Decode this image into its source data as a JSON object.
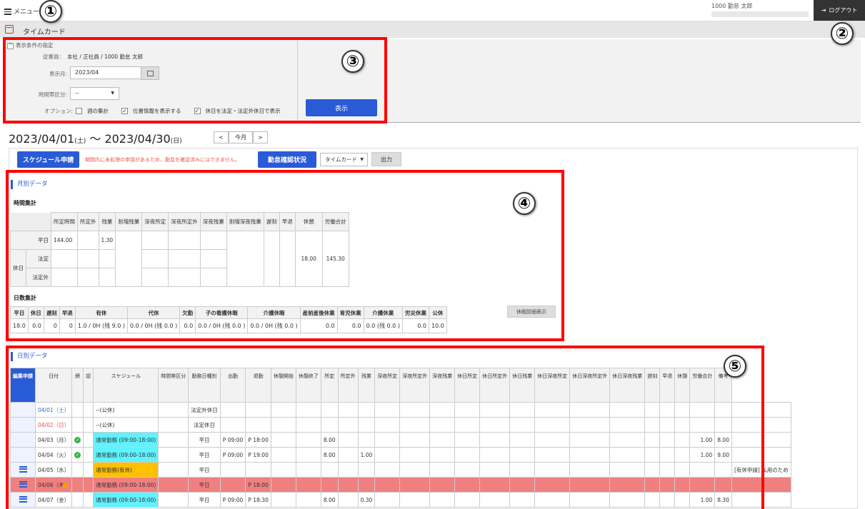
{
  "header": {
    "menu_label": "メニュー",
    "user_info": "1000 勤怠 太郎",
    "logout_label": "ログアウト"
  },
  "titlebar": {
    "title": "タイムカード"
  },
  "conditions": {
    "heading": "表示条件の指定",
    "employee_label": "従業員：",
    "employee_value": "本社 / 正社員 / 1000 勤怠 太郎",
    "month_label": "表示月:",
    "month_value": "2023/04",
    "timezone_label": "時間帯区分:",
    "timezone_value": "--",
    "options_label": "オプション:",
    "opt_weekly": "週の集計",
    "opt_location": "位置情報を表示する",
    "opt_holiday": "休日を法定・法定外休日で表示",
    "show_button": "表示"
  },
  "range": {
    "start": "2023/04/01",
    "start_dow": "(土)",
    "sep": " ～ ",
    "end": "2023/04/30",
    "end_dow": "(日)",
    "prev": "<",
    "this_month": "今月",
    "next": ">"
  },
  "toolbar": {
    "schedule_button": "スケジュール申請",
    "warning": "期間内に未処理の申請があるため、勤怠を確認済みにはできません。",
    "confirm_button": "勤怠確認状況",
    "view_select": "タイムカード",
    "output_button": "出力"
  },
  "monthly": {
    "title": "月別データ",
    "time_heading": "時間集計",
    "time_headers": [
      "所定時間",
      "所定外",
      "残業",
      "割増残業",
      "深夜所定",
      "深夜所定外",
      "深夜残業",
      "割増深夜残業",
      "遅刻",
      "早退",
      "休憩",
      "労働合計"
    ],
    "row_weekday": "平日",
    "row_holiday": "休日",
    "row_legal": "法定",
    "row_nonlegal": "法定外",
    "weekday_scheduled": "144.00",
    "weekday_overtime": "1.30",
    "break_total": "18.00",
    "work_total": "145.30",
    "days_heading": "日数集計",
    "days_headers": [
      "平日",
      "休日",
      "遅刻",
      "早退",
      "有休",
      "代休",
      "欠勤",
      "子の看護休暇",
      "介護休暇",
      "産前産後休業",
      "育児休業",
      "介護休業",
      "労災休業",
      "公休"
    ],
    "days_values": [
      "18.0",
      "0.0",
      "0",
      "0",
      "1.0 / 0H (残 9.0 )",
      "0.0 / 0H (残 0.0 )",
      "0.0",
      "0.0 / 0H (残 0.0 )",
      "0.0 / 0H (残 0.0 )",
      "0.0",
      "0.0",
      "0.0 (残 0.0 )",
      "0.0",
      "10.0"
    ],
    "leave_detail_button": "休暇詳細表示"
  },
  "daily": {
    "title": "日別データ",
    "headers": [
      "編集申請",
      "日付",
      "締",
      "認",
      "スケジュール",
      "時間帯区分",
      "勤務日種別",
      "出勤",
      "退勤",
      "休憩開始",
      "休憩終了",
      "所定",
      "所定外",
      "残業",
      "深夜所定",
      "深夜所定外",
      "深夜残業",
      "休日所定",
      "休日所定外",
      "休日残業",
      "休日深夜所定",
      "休日深夜所定外",
      "休日深夜残業",
      "遅刻",
      "早退",
      "休憩",
      "労働合計",
      "備考"
    ],
    "rows": [
      {
        "date": "04/01（土）",
        "schedule": "--(公休)",
        "daytype": "法定外休日",
        "in": "",
        "out": "",
        "sched": "",
        "ot": "",
        "brk": "",
        "total": "",
        "note": ""
      },
      {
        "date": "04/02（日）",
        "schedule": "--(公休)",
        "daytype": "法定休日",
        "in": "",
        "out": "",
        "sched": "",
        "ot": "",
        "brk": "",
        "total": "",
        "note": ""
      },
      {
        "date": "04/03（月）",
        "schedule": "通常勤務 (09:00-18:00)",
        "daytype": "平日",
        "in": "P 09:00",
        "out": "P 18:00",
        "sched": "8.00",
        "ot": "",
        "brk": "1.00",
        "total": "8.00",
        "note": ""
      },
      {
        "date": "04/04（火）",
        "schedule": "通常勤務 (09:00-18:00)",
        "daytype": "平日",
        "in": "P 09:00",
        "out": "P 19:00",
        "sched": "8.00",
        "ot": "1.00",
        "brk": "1.00",
        "total": "9.00",
        "note": ""
      },
      {
        "date": "04/05（水）",
        "schedule": "通常勤務(有休)",
        "daytype": "平日",
        "in": "",
        "out": "",
        "sched": "",
        "ot": "",
        "brk": "",
        "total": "",
        "note": "[有休申請] 私用のため"
      },
      {
        "date": "04/06（木）",
        "schedule": "通常勤務 (09:00-18:00)",
        "daytype": "平日",
        "in": "",
        "out": "P 18:00",
        "sched": "",
        "ot": "",
        "brk": "",
        "total": "",
        "note": ""
      },
      {
        "date": "04/07（金）",
        "schedule": "通常勤務 (09:00-18:00)",
        "daytype": "平日",
        "in": "P 09:00",
        "out": "P 18:30",
        "sched": "8.00",
        "ot": "0.30",
        "brk": "1.00",
        "total": "8.30",
        "note": ""
      }
    ]
  },
  "annotations": [
    "①",
    "②",
    "③",
    "④",
    "⑤"
  ],
  "colors": {
    "accent": "#2a5bd7",
    "annotation": "#ff0000",
    "highlight_cyan": "#5ff2ff",
    "highlight_orange": "#ffc000",
    "error_row": "#f08080"
  }
}
